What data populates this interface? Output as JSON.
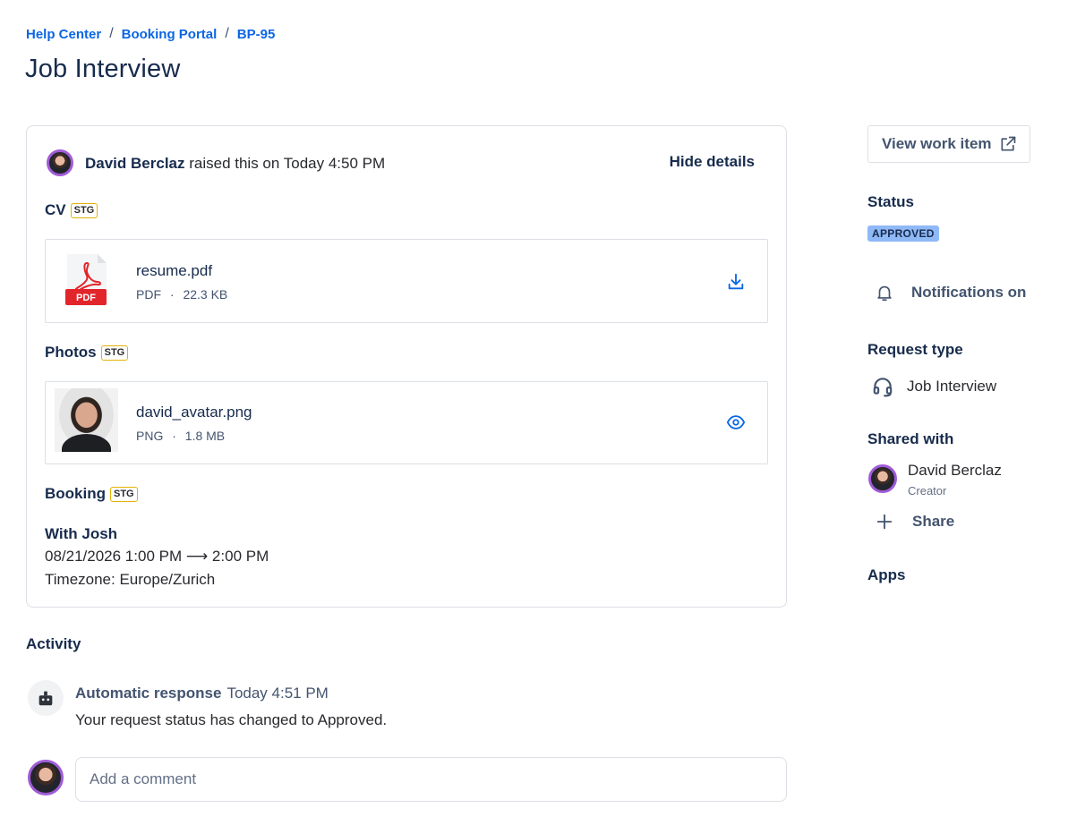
{
  "breadcrumb": {
    "items": [
      "Help Center",
      "Booking Portal",
      "BP-95"
    ],
    "separator": "/"
  },
  "page_title": "Job Interview",
  "request": {
    "raised_by": "David Berclaz",
    "raised_text": "raised this on Today 4:50 PM",
    "hide_details_label": "Hide details",
    "fields": {
      "cv": {
        "label": "CV",
        "badge": "STG",
        "file": {
          "name": "resume.pdf",
          "type": "PDF",
          "size": "22.3 KB",
          "icon_label": "PDF",
          "action_icon": "download-icon"
        }
      },
      "photos": {
        "label": "Photos",
        "badge": "STG",
        "file": {
          "name": "david_avatar.png",
          "type": "PNG",
          "size": "1.8 MB",
          "action_icon": "eye-icon"
        }
      },
      "booking": {
        "label": "Booking",
        "badge": "STG",
        "title": "With Josh",
        "time_range": "08/21/2026 1:00 PM ⟶ 2:00 PM",
        "timezone": "Timezone: Europe/Zurich"
      }
    },
    "meta_separator": "·"
  },
  "activity": {
    "title": "Activity",
    "entries": [
      {
        "author": "Automatic response",
        "time": "Today 4:51 PM",
        "text": "Your request status has changed to Approved."
      }
    ],
    "comment_placeholder": "Add a comment"
  },
  "sidebar": {
    "view_work_item_label": "View work item",
    "status_heading": "Status",
    "status_value": "APPROVED",
    "notifications_label": "Notifications on",
    "request_type_heading": "Request type",
    "request_type_value": "Job Interview",
    "shared_with_heading": "Shared with",
    "shared_user": {
      "name": "David Berclaz",
      "role": "Creator"
    },
    "share_label": "Share",
    "apps_heading": "Apps"
  },
  "colors": {
    "link": "#0c66e4",
    "status_badge_bg": "#8fb8f6",
    "lozenge_border": "#e2b203",
    "avatar_ring": "#a05bd6",
    "pdf_red": "#e2252b"
  }
}
